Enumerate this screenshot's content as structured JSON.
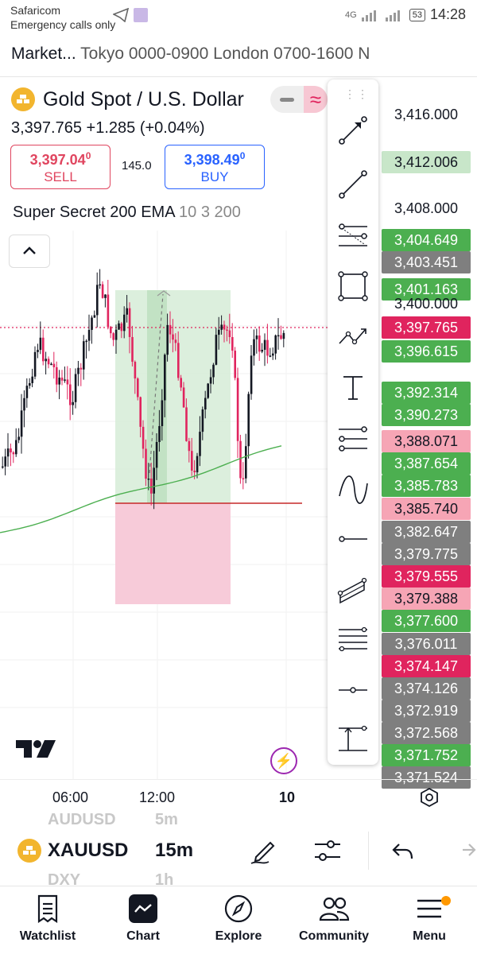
{
  "status_bar": {
    "carrier": "Safaricom",
    "emergency": "Emergency calls only",
    "network": "4G",
    "battery": "53",
    "time": "14:28"
  },
  "session_bar": {
    "market": "Market...",
    "sessions": "Tokyo 0000-0900 London 0700-1600 N"
  },
  "symbol": {
    "name": "Gold Spot / U.S. Dollar",
    "price": "3,397.765",
    "change": "+1.285",
    "change_pct": "(+0.04%)"
  },
  "trade": {
    "sell_price_main": "3,397.04",
    "sell_price_sup": "0",
    "sell_label": "SELL",
    "spread": "145.0",
    "buy_price_main": "3,398.49",
    "buy_price_sup": "0",
    "buy_label": "BUY"
  },
  "indicator": {
    "name": "Super Secret 200 EMA",
    "params": "10 3 200"
  },
  "price_scale": [
    {
      "text": "3,416.000",
      "bg": "transparent",
      "fg": "#131722"
    },
    {
      "text": "3,412.006",
      "bg": "#c8e6c9",
      "fg": "#131722"
    },
    {
      "text": "3,408.000",
      "bg": "transparent",
      "fg": "#131722"
    },
    {
      "text": "3,404.649",
      "bg": "#4caf50",
      "fg": "#ffffff"
    },
    {
      "text": "3,403.451",
      "bg": "#7f7f7f",
      "fg": "#ffffff"
    },
    {
      "text": "3,401.163",
      "bg": "#4caf50",
      "fg": "#ffffff"
    },
    {
      "text": "3,400.000",
      "bg": "transparent",
      "fg": "#131722"
    },
    {
      "text": "3,397.765",
      "bg": "#e0245e",
      "fg": "#ffffff"
    },
    {
      "text": "3,396.615",
      "bg": "#4caf50",
      "fg": "#ffffff"
    },
    {
      "text": "3,392.314",
      "bg": "#4caf50",
      "fg": "#ffffff"
    },
    {
      "text": "3,390.273",
      "bg": "#4caf50",
      "fg": "#ffffff"
    },
    {
      "text": "3,388.071",
      "bg": "#f6a5b5",
      "fg": "#131722"
    },
    {
      "text": "3,387.654",
      "bg": "#4caf50",
      "fg": "#ffffff"
    },
    {
      "text": "3,385.783",
      "bg": "#4caf50",
      "fg": "#ffffff"
    },
    {
      "text": "3,385.740",
      "bg": "#f6a5b5",
      "fg": "#131722"
    },
    {
      "text": "3,382.647",
      "bg": "#7f7f7f",
      "fg": "#ffffff"
    },
    {
      "text": "3,379.775",
      "bg": "#7f7f7f",
      "fg": "#ffffff"
    },
    {
      "text": "3,379.555",
      "bg": "#e0245e",
      "fg": "#ffffff"
    },
    {
      "text": "3,379.388",
      "bg": "#f6a5b5",
      "fg": "#131722"
    },
    {
      "text": "3,377.600",
      "bg": "#4caf50",
      "fg": "#ffffff"
    },
    {
      "text": "3,376.011",
      "bg": "#7f7f7f",
      "fg": "#ffffff"
    },
    {
      "text": "3,374.147",
      "bg": "#e0245e",
      "fg": "#ffffff"
    },
    {
      "text": "3,374.126",
      "bg": "#7f7f7f",
      "fg": "#ffffff"
    },
    {
      "text": "3,372.919",
      "bg": "#7f7f7f",
      "fg": "#ffffff"
    },
    {
      "text": "3,372.568",
      "bg": "#7f7f7f",
      "fg": "#ffffff"
    },
    {
      "text": "3,371.752",
      "bg": "#4caf50",
      "fg": "#ffffff"
    },
    {
      "text": "3,371.524",
      "bg": "#7f7f7f",
      "fg": "#ffffff"
    }
  ],
  "time_axis": {
    "t1": "06:00",
    "t2": "12:00",
    "t3": "10"
  },
  "toolbar_icons": [
    "arrow-tool-icon",
    "trend-line-icon",
    "fib-retracement-icon",
    "rectangle-tool-icon",
    "path-tool-icon",
    "text-tool-icon",
    "pitchfork-icon",
    "curve-tool-icon",
    "horizontal-ray-icon",
    "parallel-channel-icon",
    "multi-line-icon",
    "horizontal-line-icon",
    "date-price-range-icon"
  ],
  "symbol_bar": {
    "ghost_above_symbol": "AUDUSD",
    "ghost_above_tf": "5m",
    "symbol": "XAUUSD",
    "timeframe": "15m",
    "ghost_below_symbol": "DXY",
    "ghost_below_tf": "1h"
  },
  "nav": {
    "watchlist": "Watchlist",
    "chart": "Chart",
    "explore": "Explore",
    "community": "Community",
    "menu": "Menu"
  },
  "colors": {
    "bull": "#4caf50",
    "bear": "#e0245e",
    "ema": "#4caf50",
    "accent": "#2962ff"
  }
}
